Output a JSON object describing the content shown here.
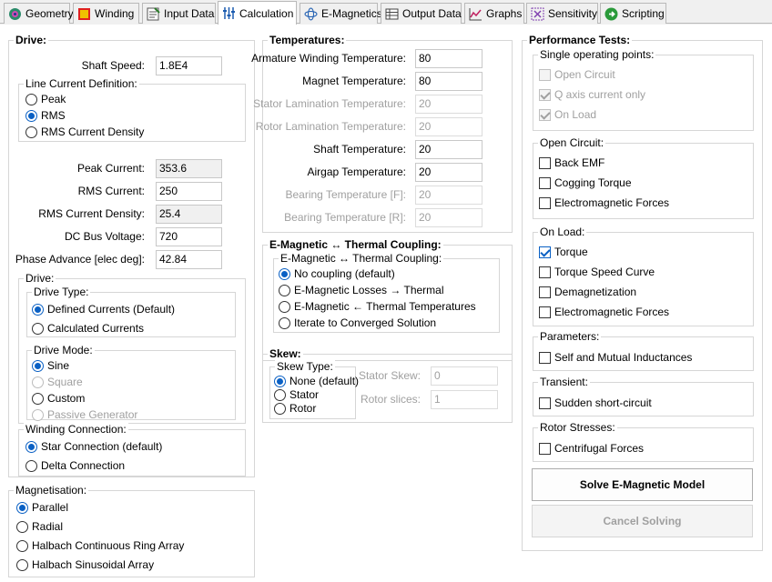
{
  "tabs": [
    {
      "label": "Geometry",
      "icon": "geometry-icon"
    },
    {
      "label": "Winding",
      "icon": "winding-icon"
    },
    {
      "label": "Input Data",
      "icon": "input-data-icon"
    },
    {
      "label": "Calculation",
      "icon": "calculation-icon",
      "active": true
    },
    {
      "label": "E-Magnetics",
      "icon": "e-magnetics-icon"
    },
    {
      "label": "Output Data",
      "icon": "output-data-icon"
    },
    {
      "label": "Graphs",
      "icon": "graphs-icon"
    },
    {
      "label": "Sensitivity",
      "icon": "sensitivity-icon"
    },
    {
      "label": "Scripting",
      "icon": "scripting-icon"
    }
  ],
  "drive": {
    "title": "Drive:",
    "shaft_speed": {
      "label": "Shaft Speed:",
      "value": "1.8E4"
    },
    "line_current": {
      "title": "Line Current Definition:",
      "peak": "Peak",
      "rms": "RMS",
      "rms_density": "RMS Current Density",
      "selected": "RMS"
    },
    "peak_current": {
      "label": "Peak Current:",
      "value": "353.6"
    },
    "rms_current": {
      "label": "RMS Current:",
      "value": "250"
    },
    "rms_current_density": {
      "label": "RMS Current Density:",
      "value": "25.4"
    },
    "dc_bus_voltage": {
      "label": "DC Bus Voltage:",
      "value": "720"
    },
    "phase_advance": {
      "label": "Phase Advance [elec deg]:",
      "value": "42.84"
    },
    "drive_group": {
      "title": "Drive:",
      "drive_type": {
        "title": "Drive Type:",
        "defined": "Defined Currents (Default)",
        "calculated": "Calculated Currents"
      },
      "drive_mode": {
        "title": "Drive Mode:",
        "sine": "Sine",
        "square": "Square",
        "custom": "Custom",
        "passive": "Passive Generator"
      }
    },
    "winding_connection": {
      "title": "Winding Connection:",
      "star": "Star Connection (default)",
      "delta": "Delta Connection"
    }
  },
  "magnetisation": {
    "title": "Magnetisation:",
    "parallel": "Parallel",
    "radial": "Radial",
    "halbach_ring": "Halbach Continuous Ring Array",
    "halbach_sin": "Halbach Sinusoidal Array"
  },
  "temperatures": {
    "title": "Temperatures:",
    "armature": {
      "label": "Armature Winding Temperature:",
      "value": "80"
    },
    "magnet": {
      "label": "Magnet Temperature:",
      "value": "80"
    },
    "stator_lam": {
      "label": "Stator Lamination Temperature:",
      "value": "20"
    },
    "rotor_lam": {
      "label": "Rotor Lamination Temperature:",
      "value": "20"
    },
    "shaft": {
      "label": "Shaft Temperature:",
      "value": "20"
    },
    "airgap": {
      "label": "Airgap Temperature:",
      "value": "20"
    },
    "bearing_f": {
      "label": "Bearing Temperature [F]:",
      "value": "20"
    },
    "bearing_r": {
      "label": "Bearing Temperature [R]:",
      "value": "20"
    }
  },
  "coupling": {
    "title": "E-Magnetic ↔ Thermal Coupling:",
    "inner_title": "E-Magnetic ↔ Thermal Coupling:",
    "none": "No coupling (default)",
    "losses": "E-Magnetic Losses → Thermal",
    "temps": "E-Magnetic  ← Thermal Temperatures",
    "iterate": "Iterate to Converged Solution"
  },
  "skew": {
    "title": "Skew:",
    "type_title": "Skew Type:",
    "none": "None (default)",
    "stator": "Stator",
    "rotor": "Rotor",
    "stator_skew": {
      "label": "Stator Skew:",
      "value": "0"
    },
    "rotor_slices": {
      "label": "Rotor slices:",
      "value": "1"
    }
  },
  "performance": {
    "title": "Performance Tests:",
    "single": {
      "title": "Single operating points:",
      "open_circuit": "Open Circuit",
      "q_axis": "Q axis current only",
      "on_load": "On Load"
    },
    "open_circuit": {
      "title": "Open Circuit:",
      "back_emf": "Back EMF",
      "cogging": "Cogging Torque",
      "em_forces": "Electromagnetic Forces"
    },
    "on_load": {
      "title": "On Load:",
      "torque": "Torque",
      "torque_speed": "Torque Speed Curve",
      "demag": "Demagnetization",
      "em_forces": "Electromagnetic Forces"
    },
    "parameters": {
      "title": "Parameters:",
      "inductances": "Self and Mutual Inductances"
    },
    "transient": {
      "title": "Transient:",
      "short_circuit": "Sudden short-circuit"
    },
    "rotor_stresses": {
      "title": "Rotor Stresses:",
      "centrifugal": "Centrifugal Forces"
    },
    "solve_label": "Solve E-Magnetic Model",
    "cancel_label": "Cancel Solving"
  }
}
